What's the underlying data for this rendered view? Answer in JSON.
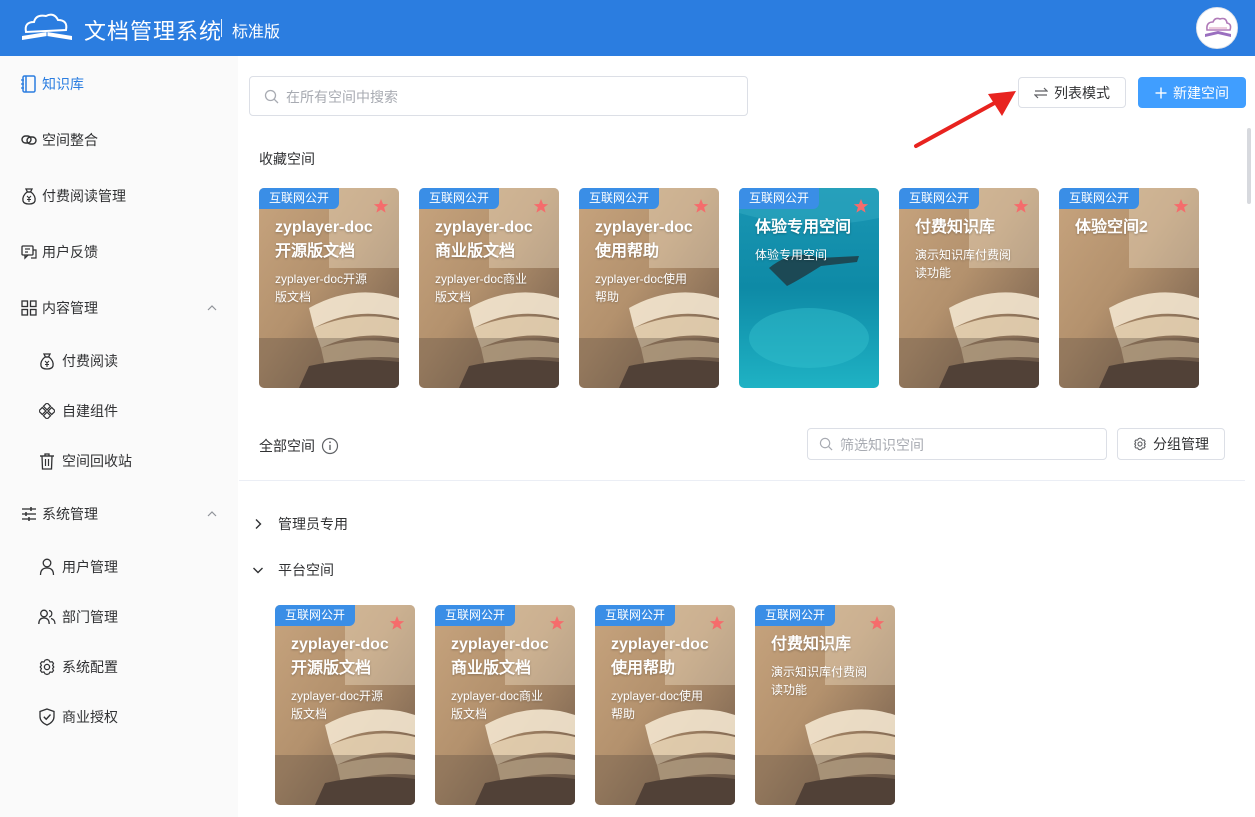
{
  "header": {
    "title": "文档管理系统",
    "edition": "标准版"
  },
  "sidebar": {
    "items": [
      {
        "label": "知识库",
        "icon": "book-icon",
        "active": true
      },
      {
        "label": "空间整合",
        "icon": "link-icon"
      },
      {
        "label": "付费阅读管理",
        "icon": "money-bag-icon"
      },
      {
        "label": "用户反馈",
        "icon": "feedback-icon"
      },
      {
        "label": "内容管理",
        "icon": "grid-icon",
        "expanded": true
      },
      {
        "label": "付费阅读",
        "icon": "money-bag-icon"
      },
      {
        "label": "自建组件",
        "icon": "component-icon"
      },
      {
        "label": "空间回收站",
        "icon": "trash-icon"
      },
      {
        "label": "系统管理",
        "icon": "sliders-icon",
        "expanded": true
      },
      {
        "label": "用户管理",
        "icon": "user-icon"
      },
      {
        "label": "部门管理",
        "icon": "users-icon"
      },
      {
        "label": "系统配置",
        "icon": "gear-icon"
      },
      {
        "label": "商业授权",
        "icon": "shield-check-icon"
      }
    ]
  },
  "search": {
    "placeholder": "在所有空间中搜索"
  },
  "toolbar": {
    "list_mode_label": "列表模式",
    "new_space_label": "新建空间"
  },
  "favorites": {
    "title": "收藏空间",
    "cards": [
      {
        "badge": "互联网公开",
        "line1": "zyplayer-doc",
        "line2": "开源版文档",
        "desc1": "zyplayer-doc开源",
        "desc2": "版文档"
      },
      {
        "badge": "互联网公开",
        "line1": "zyplayer-doc",
        "line2": "商业版文档",
        "desc1": "zyplayer-doc商业",
        "desc2": "版文档"
      },
      {
        "badge": "互联网公开",
        "line1": "zyplayer-doc",
        "line2": "使用帮助",
        "desc1": "zyplayer-doc使用",
        "desc2": "帮助"
      },
      {
        "badge": "互联网公开",
        "line1": "体验专用空间",
        "line2": "",
        "desc1": "体验专用空间",
        "desc2": ""
      },
      {
        "badge": "互联网公开",
        "line1": "付费知识库",
        "line2": "",
        "desc1": "演示知识库付费阅",
        "desc2": "读功能"
      },
      {
        "badge": "互联网公开",
        "line1": "体验空间2",
        "line2": "",
        "desc1": "",
        "desc2": ""
      }
    ]
  },
  "all_spaces": {
    "title": "全部空间",
    "filter_placeholder": "筛选知识空间",
    "group_manage_label": "分组管理",
    "groups": [
      {
        "label": "管理员专用",
        "expanded": false
      },
      {
        "label": "平台空间",
        "expanded": true
      }
    ],
    "cards": [
      {
        "badge": "互联网公开",
        "line1": "zyplayer-doc",
        "line2": "开源版文档",
        "desc1": "zyplayer-doc开源",
        "desc2": "版文档"
      },
      {
        "badge": "互联网公开",
        "line1": "zyplayer-doc",
        "line2": "商业版文档",
        "desc1": "zyplayer-doc商业",
        "desc2": "版文档"
      },
      {
        "badge": "互联网公开",
        "line1": "zyplayer-doc",
        "line2": "使用帮助",
        "desc1": "zyplayer-doc使用",
        "desc2": "帮助"
      },
      {
        "badge": "互联网公开",
        "line1": "付费知识库",
        "line2": "",
        "desc1": "演示知识库付费阅",
        "desc2": "读功能"
      }
    ]
  },
  "colors": {
    "header": "#2b7de0",
    "primary": "#409eff",
    "badge": "#3a8ee6",
    "star": "#f56c6c",
    "annotation_arrow": "#e8231f"
  }
}
